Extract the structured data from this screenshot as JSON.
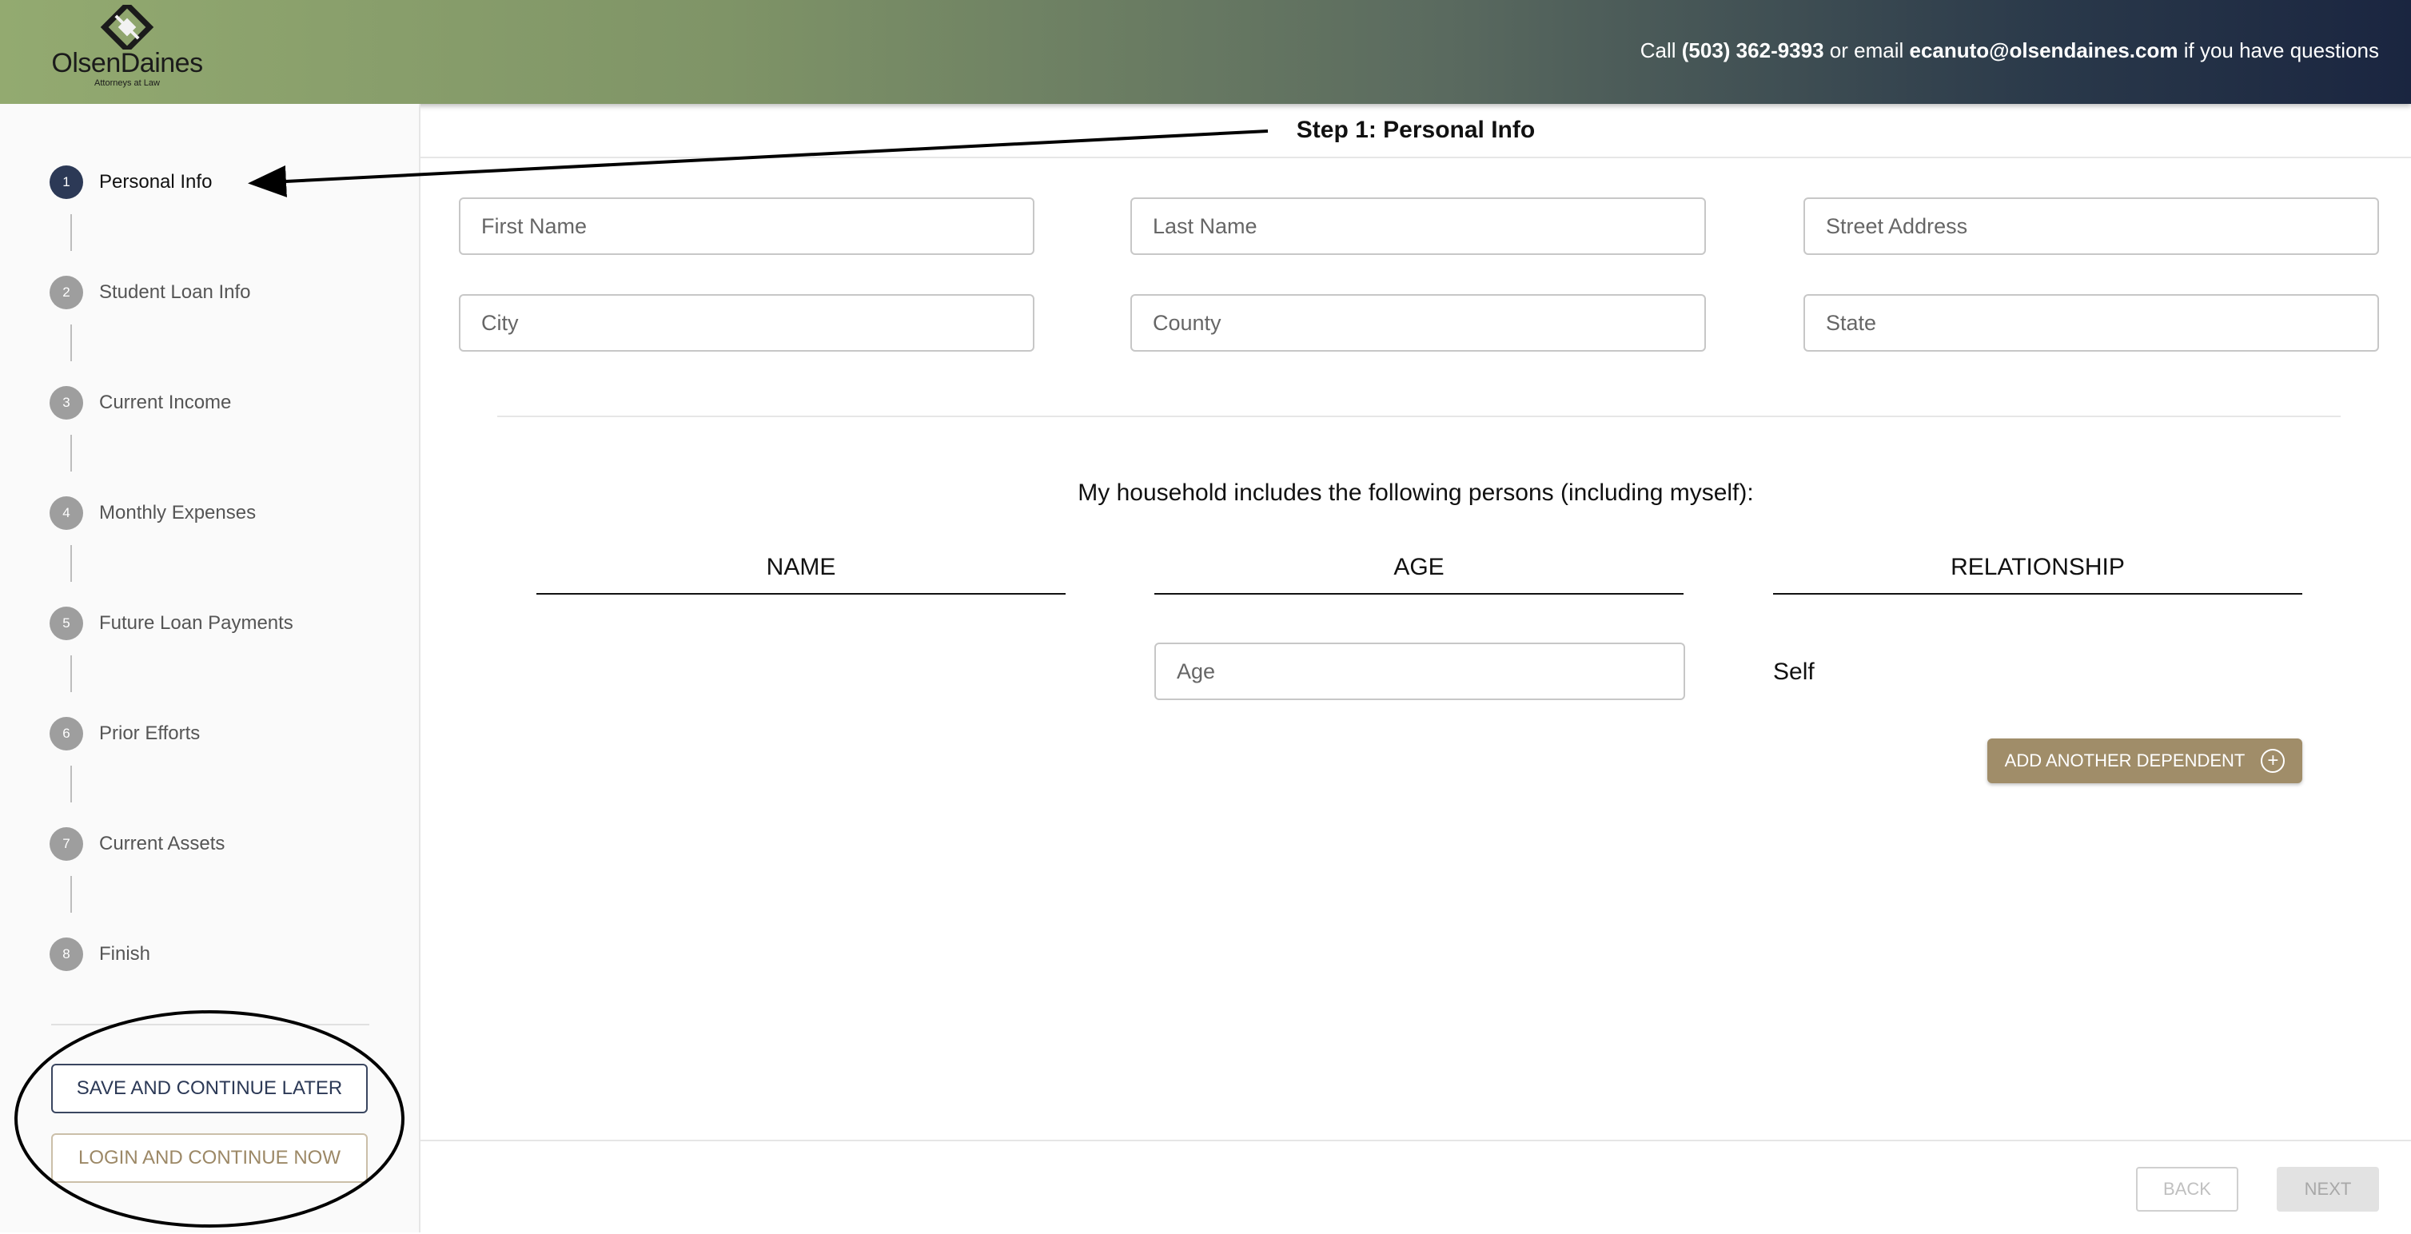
{
  "header": {
    "logo_name": "OlsenDaines",
    "logo_sub": "Attorneys at Law",
    "contact": {
      "prefix": "Call ",
      "phone": "(503) 362-9393",
      "middle": " or email ",
      "email": "ecanuto@olsendaines.com",
      "suffix": " if you have questions"
    }
  },
  "sidebar": {
    "steps": [
      {
        "number": "1",
        "label": "Personal Info",
        "active": true
      },
      {
        "number": "2",
        "label": "Student Loan Info"
      },
      {
        "number": "3",
        "label": "Current Income"
      },
      {
        "number": "4",
        "label": "Monthly Expenses"
      },
      {
        "number": "5",
        "label": "Future Loan Payments"
      },
      {
        "number": "6",
        "label": "Prior Efforts"
      },
      {
        "number": "7",
        "label": "Current Assets"
      },
      {
        "number": "8",
        "label": "Finish"
      }
    ],
    "save_label": "SAVE AND CONTINUE LATER",
    "login_label": "LOGIN AND CONTINUE NOW"
  },
  "main": {
    "step_title": "Step 1: Personal Info",
    "fields": {
      "first_name": "First Name",
      "last_name": "Last Name",
      "street": "Street Address",
      "city": "City",
      "county": "County",
      "state": "State"
    },
    "household_title": "My household includes the following persons (including myself):",
    "columns": {
      "name": "NAME",
      "age": "AGE",
      "relationship": "RELATIONSHIP"
    },
    "age_placeholder": "Age",
    "self_relationship": "Self",
    "add_dependent_label": "ADD ANOTHER DEPENDENT"
  },
  "footer": {
    "back_label": "BACK",
    "next_label": "NEXT"
  },
  "colors": {
    "accent_dark": "#2c3956",
    "accent_tan": "#a08d69"
  }
}
